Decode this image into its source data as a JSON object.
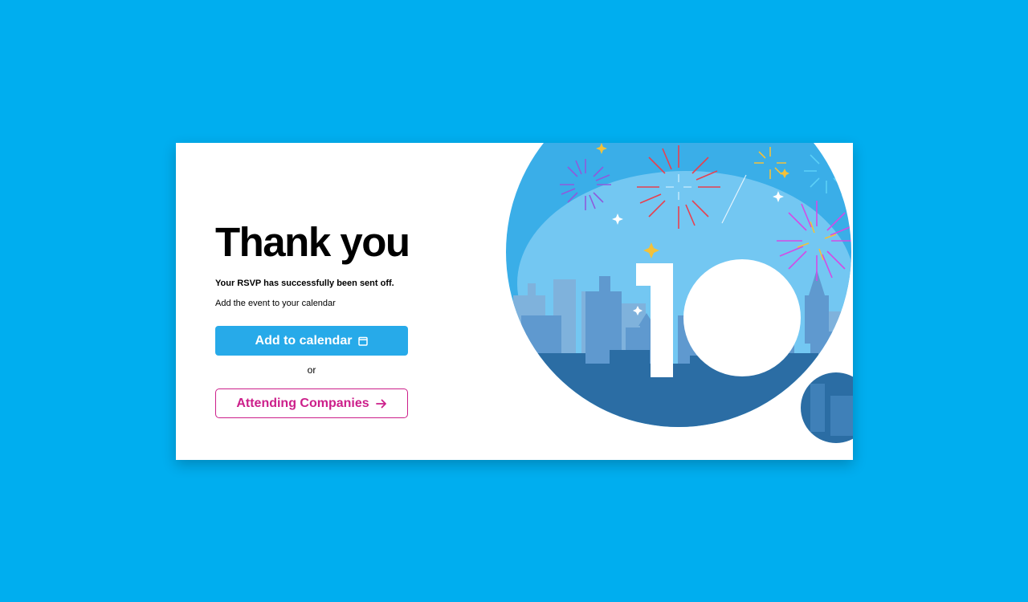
{
  "hero": {
    "title": "Thank you",
    "subtitle": "Your RSVP has successfully been sent off.",
    "helper": "Add the event to your calendar"
  },
  "actions": {
    "add_calendar_label": "Add to calendar",
    "add_calendar_icon": "calendar-icon",
    "separator": "or",
    "companies_label": "Attending Companies",
    "companies_icon": "arrow-right-icon"
  },
  "illustration": {
    "number_text": "10",
    "theme": "city skyline with fireworks"
  },
  "colors": {
    "page_background": "#00aeef",
    "primary_button": "#27aae9",
    "secondary_accent": "#cc1f8a",
    "sky_blue": "#3aaee8",
    "skyline_dark": "#2b6da4"
  }
}
